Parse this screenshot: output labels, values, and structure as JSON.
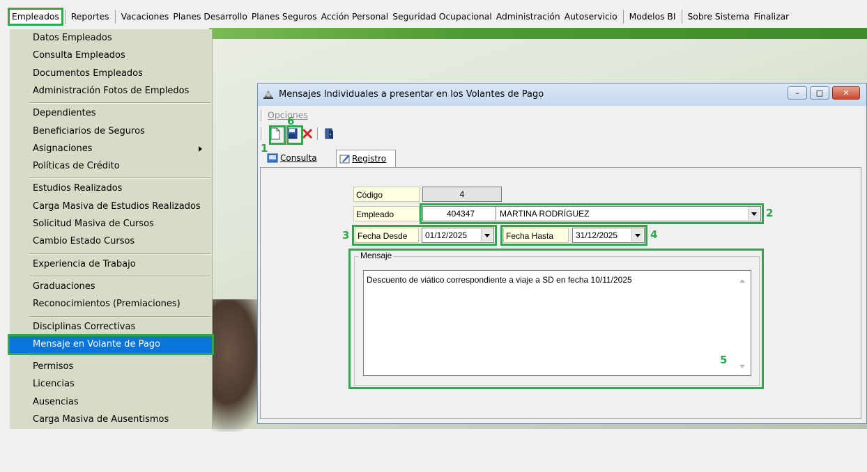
{
  "menubar": {
    "items": [
      "Empleados",
      "Reportes",
      "Vacaciones",
      "Planes Desarrollo",
      "Planes Seguros",
      "Acción Personal",
      "Seguridad Ocupacional",
      "Administración",
      "Autoservicio",
      "Modelos BI",
      "Sobre Sistema",
      "Finalizar"
    ]
  },
  "dropdown": {
    "groups": [
      [
        "Datos Empleados",
        "Consulta Empleados",
        "Documentos Empleados",
        "Administración Fotos de Empledos"
      ],
      [
        "Dependientes",
        "Beneficiarios de Seguros",
        "Asignaciones",
        "Políticas de Crédito"
      ],
      [
        "Estudios Realizados",
        "Carga Masiva de Estudios Realizados",
        "Solicitud Masiva de Cursos",
        "Cambio Estado Cursos"
      ],
      [
        "Experiencia de Trabajo"
      ],
      [
        "Graduaciones",
        "Reconocimientos (Premiaciones)"
      ],
      [
        "Disciplinas Correctivas",
        "Mensaje en Volante de Pago"
      ],
      [
        "Permisos",
        "Licencias",
        "Ausencias",
        "Carga Masiva de Ausentismos"
      ]
    ],
    "selected": "Mensaje en Volante de Pago",
    "submenu_item": "Asignaciones"
  },
  "window": {
    "title": "Mensajes Individuales a presentar en los Volantes de Pago",
    "menu_opciones": "Opciones",
    "tabs": [
      "Consulta",
      "Registro"
    ],
    "active_tab": "Registro"
  },
  "form": {
    "codigo_label": "Código",
    "codigo_value": "4",
    "empleado_label": "Empleado",
    "empleado_id": "404347",
    "empleado_name": "MARTINA RODRÍGUEZ",
    "fecha_desde_label": "Fecha Desde",
    "fecha_desde_value": "01/12/2025",
    "fecha_hasta_label": "Fecha Hasta",
    "fecha_hasta_value": "31/12/2025",
    "mensaje_label": "Mensaje",
    "mensaje_text": "Descuento de viático correspondiente a viaje a SD en fecha 10/11/2025"
  },
  "annotations": {
    "n1": "1",
    "n2": "2",
    "n3": "3",
    "n4": "4",
    "n5": "5",
    "n6": "6"
  },
  "colors": {
    "highlight": "#2ea84a",
    "selection": "#0a74d8",
    "menu_bg": "#d6dcc6"
  },
  "icons": [
    "new-document-icon",
    "save-icon",
    "delete-icon",
    "exit-door-icon",
    "window-app-icon",
    "consulta-tab-icon",
    "registro-tab-icon"
  ]
}
